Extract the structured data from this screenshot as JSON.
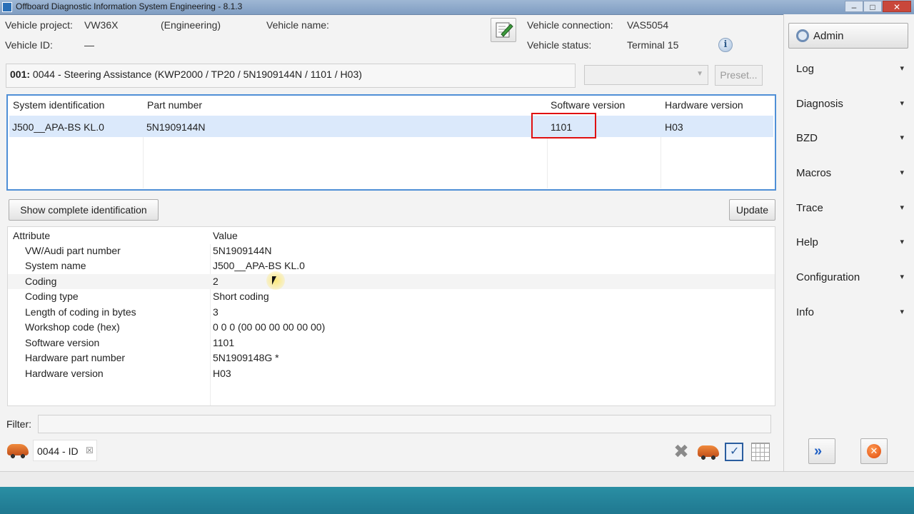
{
  "window": {
    "title": "Offboard Diagnostic Information System Engineering - 8.1.3",
    "minimize": "‒",
    "maximize": "□",
    "close": "✕"
  },
  "vehicle": {
    "project_label": "Vehicle project:",
    "project_value": "VW36X",
    "mode": "(Engineering)",
    "name_label": "Vehicle name:",
    "name_value": "",
    "id_label": "Vehicle ID:",
    "id_value": "—",
    "connection_label": "Vehicle connection:",
    "connection_value": "VAS5054",
    "status_label": "Vehicle status:",
    "status_value": "Terminal 15"
  },
  "info_icon_glyph": "i",
  "system_title": {
    "prefix": "001:",
    "text": "0044 - Steering Assistance  (KWP2000 / TP20 / 5N1909144N / 1101 / H03)"
  },
  "preset_label": "Preset...",
  "combo_arrow": "▼",
  "id_table": {
    "headers": [
      "System identification",
      "Part number",
      "Software version",
      "Hardware version"
    ],
    "row": [
      "J500__APA-BS KL.0",
      "5N1909144N",
      "1101",
      "H03"
    ]
  },
  "buttons": {
    "show_complete": "Show complete identification",
    "update": "Update"
  },
  "attr_table": {
    "headers": [
      "Attribute",
      "Value"
    ],
    "rows": [
      {
        "attribute": "VW/Audi part number",
        "value": "5N1909144N"
      },
      {
        "attribute": "System name",
        "value": "J500__APA-BS KL.0"
      },
      {
        "attribute": "Coding",
        "value": "2"
      },
      {
        "attribute": "Coding type",
        "value": "Short coding"
      },
      {
        "attribute": "Length of coding in bytes",
        "value": "3"
      },
      {
        "attribute": "Workshop code (hex)",
        "value": "0 0 0 (00 00 00 00 00 00)"
      },
      {
        "attribute": "Software version",
        "value": "1101"
      },
      {
        "attribute": "Hardware part number",
        "value": "5N1909148G  *"
      },
      {
        "attribute": "Hardware version",
        "value": "H03"
      }
    ]
  },
  "filter": {
    "label": "Filter:",
    "value": ""
  },
  "tab": {
    "label": "0044 - ID",
    "close": "☒"
  },
  "toolbar": {
    "x_glyph": "✖"
  },
  "side_menu": {
    "admin": "Admin",
    "chevron": "▾",
    "items": [
      "Log",
      "Diagnosis",
      "BZD",
      "Macros",
      "Trace",
      "Help",
      "Configuration",
      "Info"
    ]
  },
  "nav": {
    "forward_glyph": "»",
    "stop_glyph": "✕"
  },
  "colors": {
    "selection_border": "#4f8fd6",
    "highlight_box": "#e01010",
    "selected_row": "#dbe9fb"
  }
}
